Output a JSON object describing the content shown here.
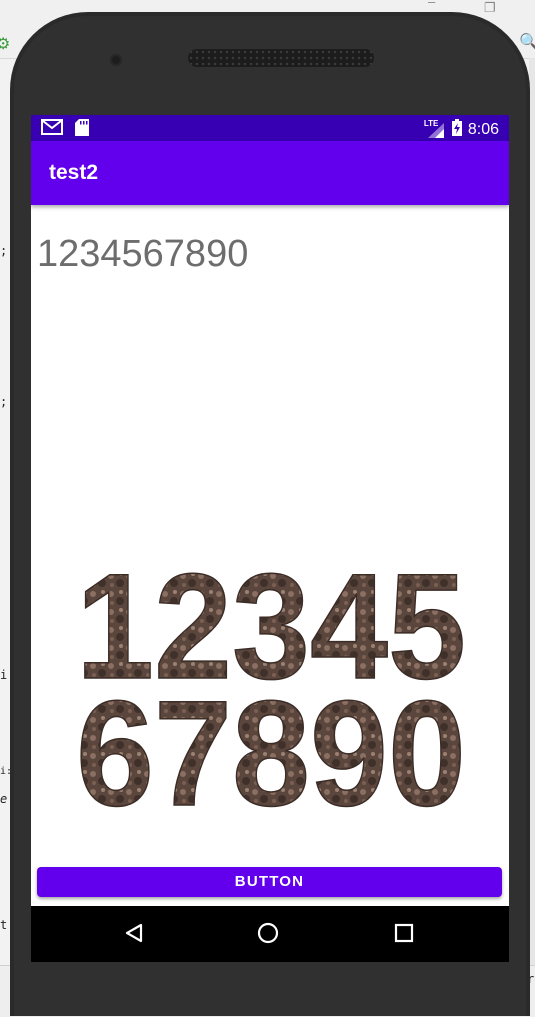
{
  "status_bar": {
    "network": "LTE",
    "time": "8:06"
  },
  "app_bar": {
    "title": "test2"
  },
  "content": {
    "number_text": "1234567890",
    "image_digits_row1": "12345",
    "image_digits_row2": "67890"
  },
  "button": {
    "label": "BUTTON"
  },
  "colors": {
    "status_bar": "#3700b3",
    "app_bar": "#6200ee",
    "button": "#6200ee",
    "digit_texture_dark": "#4a3a33",
    "digit_texture_light": "#8a6f62"
  },
  "ide_marks": [
    ";",
    ";",
    "i:",
    "i:",
    "e",
    "t",
    "r"
  ]
}
